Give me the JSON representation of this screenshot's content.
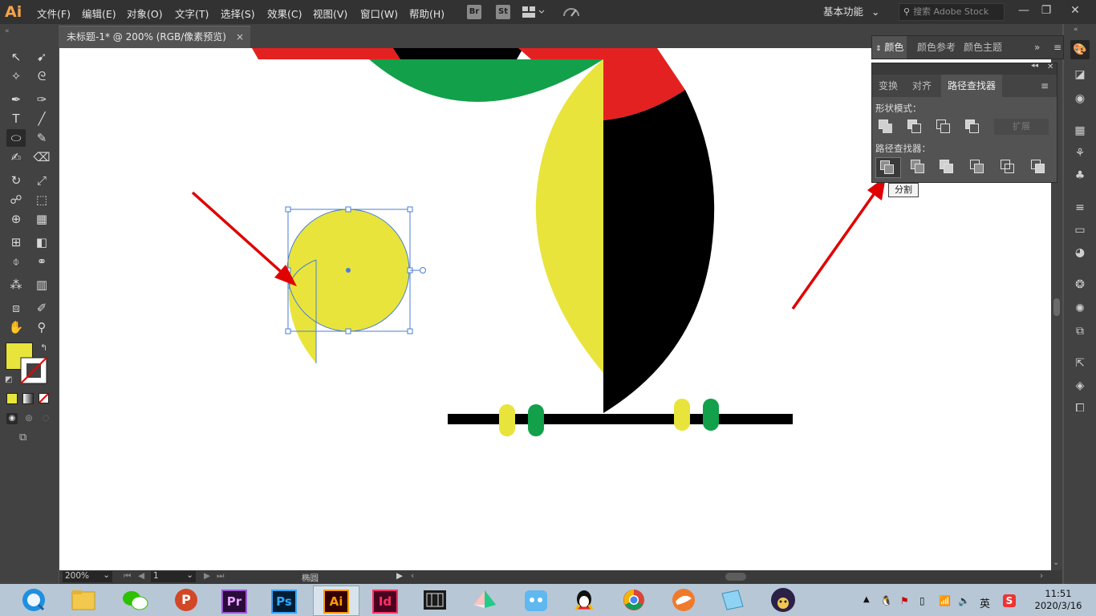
{
  "app": {
    "logo": "Ai",
    "menu": [
      "文件(F)",
      "编辑(E)",
      "对象(O)",
      "文字(T)",
      "选择(S)",
      "效果(C)",
      "视图(V)",
      "窗口(W)",
      "帮助(H)"
    ],
    "bridge_label": "Br",
    "stock_label": "St",
    "workspace": "基本功能",
    "search_placeholder": "搜索 Adobe Stock"
  },
  "document": {
    "tab_title": "未标题-1* @ 200% (RGB/像素预览)",
    "close_symbol": "×"
  },
  "status": {
    "zoom": "200%",
    "artboard": "1",
    "selection": "椭圆"
  },
  "color_panel": {
    "tabs": [
      "颜色",
      "颜色参考",
      "颜色主题"
    ]
  },
  "pathfinder_panel": {
    "tabs": [
      "变换",
      "对齐",
      "路径查找器"
    ],
    "shape_modes_label": "形状模式：",
    "expand_label": "扩展",
    "pathfinders_label": "路径查找器：",
    "tooltip": "分割"
  },
  "tools": {
    "fill_color": "#e8e43c",
    "stroke": "none"
  },
  "artwork": {
    "red": "#e42121",
    "green": "#12a04a",
    "yellow": "#e8e43c",
    "black": "#000000",
    "selection_color": "#4a7fd6",
    "arrow_color": "#e00000"
  },
  "taskbar": {
    "apps": [
      "start",
      "explorer",
      "wechat",
      "powerpoint",
      "premiere",
      "photoshop",
      "illustrator",
      "indesign",
      "video-editor",
      "app-umbrella",
      "app-cat",
      "qq",
      "chrome",
      "app-bird",
      "app-notebook",
      "app-avatar"
    ],
    "ppt_label": "P",
    "pr_label": "Pr",
    "ps_label": "Ps",
    "ai_label": "Ai",
    "id_label": "Id",
    "ime": "英",
    "time": "11:51",
    "date": "2020/3/16"
  }
}
